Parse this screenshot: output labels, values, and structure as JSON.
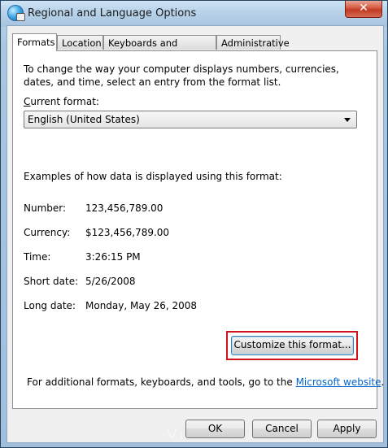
{
  "window": {
    "title": "Regional and Language Options",
    "close_label": "✕"
  },
  "tabs": [
    {
      "label": "Formats",
      "active": true
    },
    {
      "label": "Location",
      "active": false
    },
    {
      "label": "Keyboards and Languages",
      "active": false
    },
    {
      "label": "Administrative",
      "active": false
    }
  ],
  "formats": {
    "description": "To change the way your computer displays numbers, currencies, dates, and time, select an entry from the format list.",
    "current_format_label_mnemonic": "C",
    "current_format_label_rest": "urrent format:",
    "current_format_value": "English (United States)",
    "examples_heading": "Examples of how data is displayed using this format:",
    "examples": [
      {
        "label": "Number:",
        "value": "123,456,789.00"
      },
      {
        "label": "Currency:",
        "value": "$123,456,789.00"
      },
      {
        "label": "Time:",
        "value": "3:26:15 PM"
      },
      {
        "label": "Short date:",
        "value": "5/26/2008"
      },
      {
        "label": "Long date:",
        "value": "Monday, May 26, 2008"
      }
    ],
    "customize_button": "Customize this format...",
    "footer_text": "For additional formats, keyboards, and tools, go to the ",
    "footer_link": "Microsoft website",
    "footer_end": "."
  },
  "watermark": "Vistax64.com",
  "buttons": {
    "ok": "OK",
    "cancel": "Cancel",
    "apply": "Apply"
  },
  "colors": {
    "highlight_border": "#d0131a",
    "link": "#0066cc",
    "close_button": "#c13a23"
  }
}
